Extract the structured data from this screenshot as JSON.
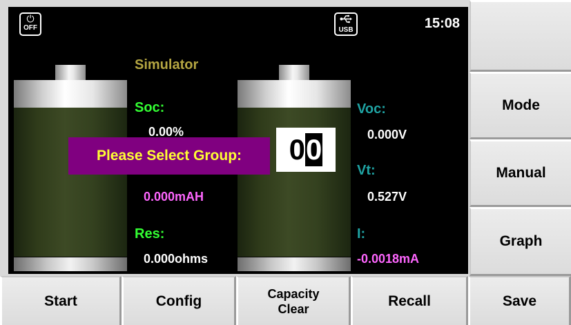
{
  "status_bar": {
    "off_label": "OFF",
    "power_icon": "⏻",
    "usb_label": "USB",
    "usb_icon": "⭠",
    "time": "15:08"
  },
  "mode_title": "Simulator",
  "left_readouts": {
    "soc_label": "Soc:",
    "soc_value": "0.00%",
    "capacity_value": "0.000mAH",
    "res_label": "Res:",
    "res_value": "0.000ohms"
  },
  "right_readouts": {
    "voc_label": "Voc:",
    "voc_value": "0.000V",
    "vt_label": "Vt:",
    "vt_value": "0.527V",
    "i_label": "I:",
    "i_value": "-0.0018mA"
  },
  "dialog": {
    "prompt": "Please Select Group:",
    "digit_first": "0",
    "digit_cursor": "0"
  },
  "side_buttons": {
    "blank": "",
    "mode": "Mode",
    "manual": "Manual",
    "graph": "Graph"
  },
  "bottom_buttons": {
    "start": "Start",
    "config": "Config",
    "capacity_line1": "Capacity",
    "capacity_line2": "Clear",
    "recall": "Recall",
    "save": "Save"
  },
  "colors": {
    "screen_bg": "#000000",
    "title": "#b5a642",
    "soc_res_label": "#33ff33",
    "capacity_value": "#ff66ff",
    "right_label": "#1fa3a3",
    "current_value": "#ff66ff",
    "popup_bg": "#800080",
    "popup_text": "#ffff33",
    "button_bg": "#e0e0e0"
  }
}
